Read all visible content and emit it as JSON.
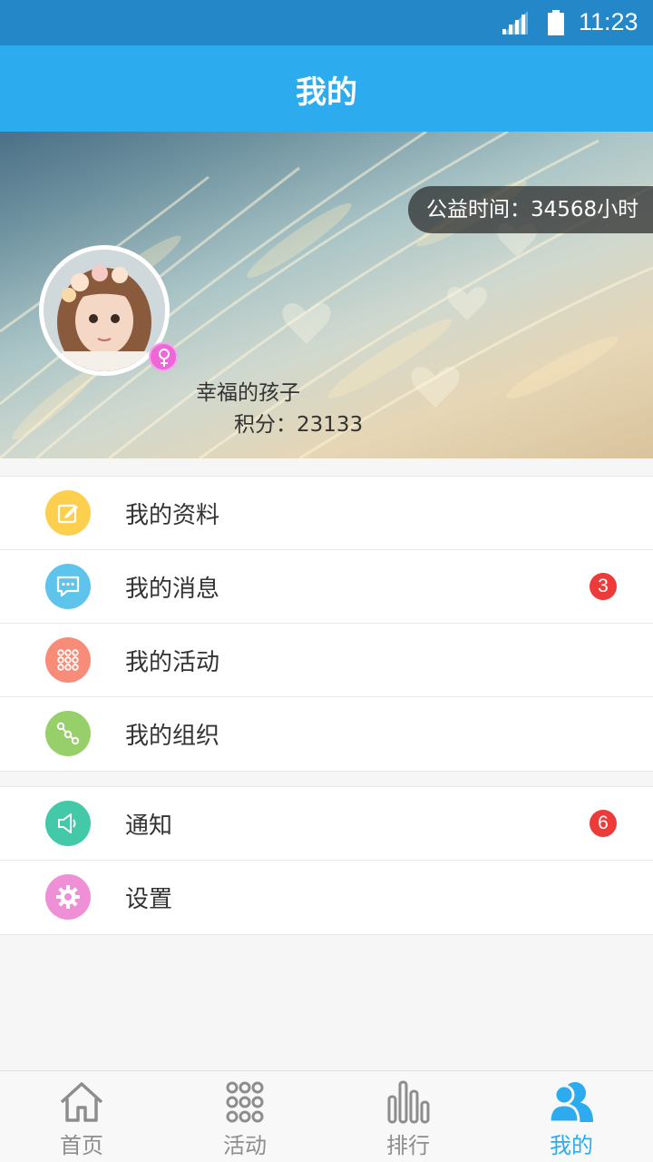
{
  "status_bar": {
    "time": "11:23"
  },
  "header": {
    "title": "我的"
  },
  "profile": {
    "service_hours": "公益时间：34568小时",
    "username": "幸福的孩子",
    "points": "积分：23133"
  },
  "menu_primary": [
    {
      "label": "我的资料",
      "icon": "edit-icon",
      "color": "#fcd04e"
    },
    {
      "label": "我的消息",
      "icon": "message-icon",
      "color": "#5fc4eb",
      "badge": "3"
    },
    {
      "label": "我的活动",
      "icon": "grid-dots-icon",
      "color": "#f98c78"
    },
    {
      "label": "我的组织",
      "icon": "nodes-icon",
      "color": "#97cf6a"
    }
  ],
  "menu_secondary": [
    {
      "label": "通知",
      "icon": "speaker-icon",
      "color": "#43c9a7",
      "badge": "6"
    },
    {
      "label": "设置",
      "icon": "gear-icon",
      "color": "#ef8fd6"
    }
  ],
  "tabs": [
    {
      "label": "首页",
      "icon": "home-icon",
      "active": false
    },
    {
      "label": "活动",
      "icon": "grid-dots-icon",
      "active": false
    },
    {
      "label": "排行",
      "icon": "bar-chart-icon",
      "active": false
    },
    {
      "label": "我的",
      "icon": "people-icon",
      "active": true
    }
  ],
  "colors": {
    "status_bar": "#2487c7",
    "title_bar": "#2cabee",
    "active_tab": "#2cabee",
    "badge": "#ef3a3a"
  }
}
